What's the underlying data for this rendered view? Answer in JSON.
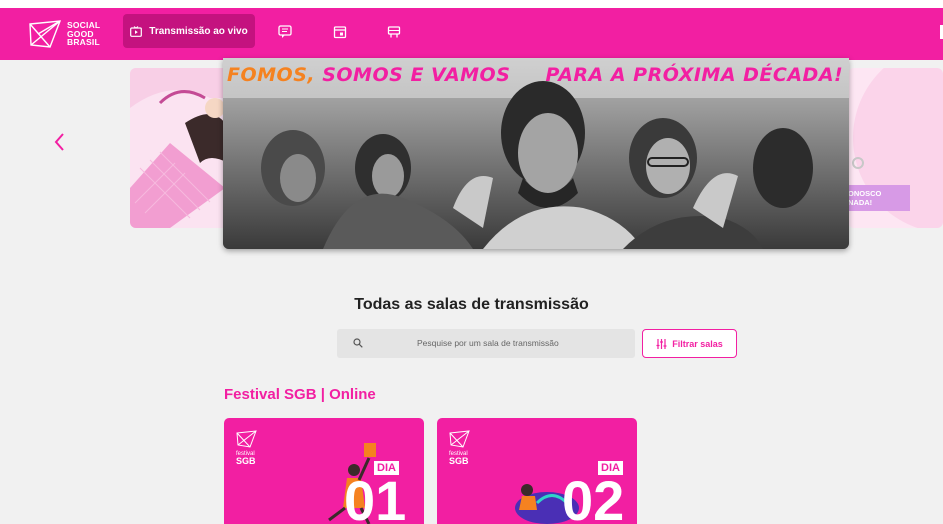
{
  "brand": {
    "line1": "SOCIAL",
    "line2": "GOOD",
    "line3": "BRASIL"
  },
  "nav": {
    "live_label": "Transmissão ao vivo",
    "icons": [
      "chat-icon",
      "calendar-icon",
      "sponsors-icon"
    ]
  },
  "banner": {
    "headline_1": "FOMOS,",
    "headline_2": "SOMOS",
    "headline_3": "E VAMOS",
    "headline_4": "PARA A PRÓXIMA DÉCADA!"
  },
  "right_slide": {
    "cta_line1": "ONOSCO",
    "cta_line2": "NADA!"
  },
  "section": {
    "title": "Todas as salas de transmissão",
    "search_placeholder": "Pesquise por um sala de transmissão",
    "filter_label": "Filtrar salas"
  },
  "group": {
    "title": "Festival SGB | Online",
    "cards": [
      {
        "fest": "festival",
        "sgb": "SGB",
        "dia": "DIA",
        "num": "01"
      },
      {
        "fest": "festival",
        "sgb": "SGB",
        "dia": "DIA",
        "num": "02"
      }
    ]
  },
  "colors": {
    "brand_pink": "#f21fa2",
    "dark_pink": "#c4127f",
    "background": "#f1f1f1"
  }
}
